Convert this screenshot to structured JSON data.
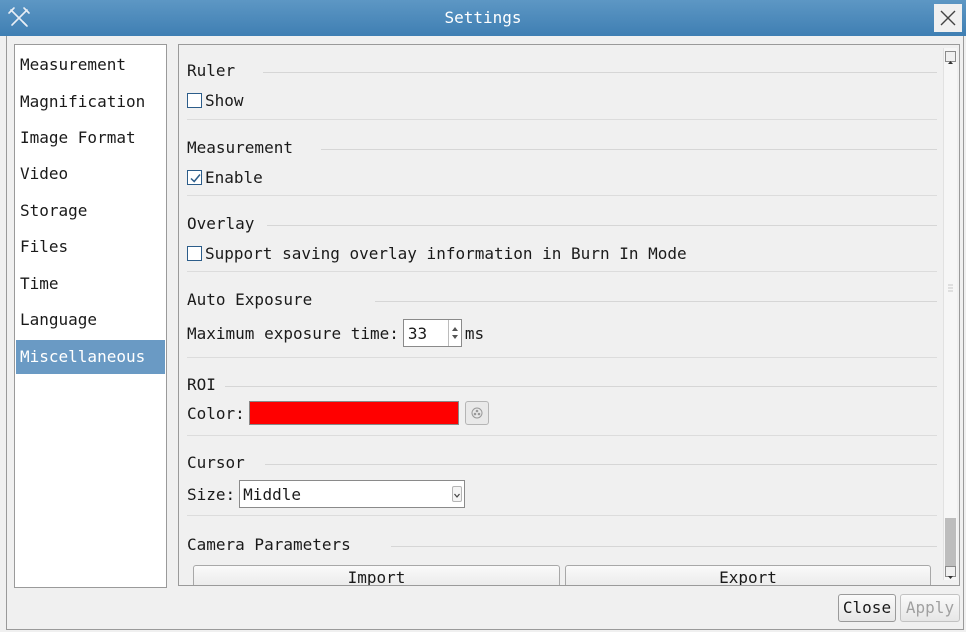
{
  "window": {
    "title": "Settings",
    "app_icon": "tools-icon",
    "close_icon": "close-icon"
  },
  "nav": {
    "items": [
      {
        "label": "Measurement"
      },
      {
        "label": "Magnification"
      },
      {
        "label": "Image Format"
      },
      {
        "label": "Video"
      },
      {
        "label": "Storage"
      },
      {
        "label": "Files"
      },
      {
        "label": "Time"
      },
      {
        "label": "Language"
      },
      {
        "label": "Miscellaneous",
        "selected": true
      }
    ]
  },
  "sections": {
    "ruler": {
      "title": "Ruler",
      "show_label": "Show",
      "show_checked": false
    },
    "measurement": {
      "title": "Measurement",
      "enable_label": "Enable",
      "enable_checked": true
    },
    "overlay": {
      "title": "Overlay",
      "support_label": "Support saving overlay information in Burn In Mode",
      "support_checked": false
    },
    "auto_exposure": {
      "title": "Auto Exposure",
      "max_label": "Maximum exposure time:",
      "max_value": "33",
      "unit": "ms"
    },
    "roi": {
      "title": "ROI",
      "color_label": "Color:",
      "color_value": "#ff0000"
    },
    "cursor": {
      "title": "Cursor",
      "size_label": "Size:",
      "size_value": "Middle"
    },
    "camera_parameters": {
      "title": "Camera Parameters",
      "import_label": "Import",
      "export_label": "Export"
    }
  },
  "footer": {
    "close_label": "Close",
    "apply_label": "Apply",
    "apply_enabled": false
  },
  "colors": {
    "titlebar": "#4a88ba",
    "selected_nav": "#6a9ac4",
    "roi_swatch": "#ff0000"
  }
}
